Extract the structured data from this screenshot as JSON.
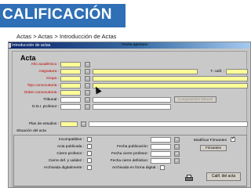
{
  "slide": {
    "title": "CALIFICACIÓN",
    "breadcrumb": "Actas > Actas > Introducción de Actas"
  },
  "window": {
    "title": "Introducción de actas"
  },
  "form": {
    "heading": "Acta",
    "labels": {
      "ano_academico": "Año académico :",
      "asignatura": "Asignatura :",
      "grupo": "Grupo :",
      "tipo_convocatoria": "Tipo convocatoria :",
      "orden_convocatoria": "Orden convocatoria :",
      "t_calif": "T. calif. :",
      "tribunal": "Tribunal :",
      "dni_profesor": "D.N.I. profesor :",
      "plan_estudios": "Plan de estudios :",
      "situacion_acta": "Situación del acta",
      "incompatibles": "Incompatibles :",
      "acta_publicada": "Acta publicada :",
      "cierre_profesor": "Cierre profesor :",
      "cierre_definitivo_y_validez": "Cierre def. y validez :",
      "archivada_digitalmente": "Archivada digitalmente :",
      "fecha_apertura": "Fecha apertura:",
      "fecha_publicacion": "Fecha publicación:",
      "fecha_cierre_profesor": "Fecha cierre profesor:",
      "fecha_cierre_definitivo": "Fecha cierre definitivo:",
      "archivada_forma_digital": "Archivada en forma digital :",
      "modificar_firmantes": "Modificar Firmantes"
    },
    "buttons": {
      "componentes_tribunal": "Componentes tribunal",
      "firmantes": "Firmantes",
      "calificar_acta": "Calif. del acta"
    },
    "values": {
      "modificar_firmantes_checked": true
    }
  },
  "colors": {
    "banner": "#2e6fb5",
    "required_field": "#ffff99",
    "required_label": "#c00000",
    "window_bg": "#c6c6c6"
  }
}
